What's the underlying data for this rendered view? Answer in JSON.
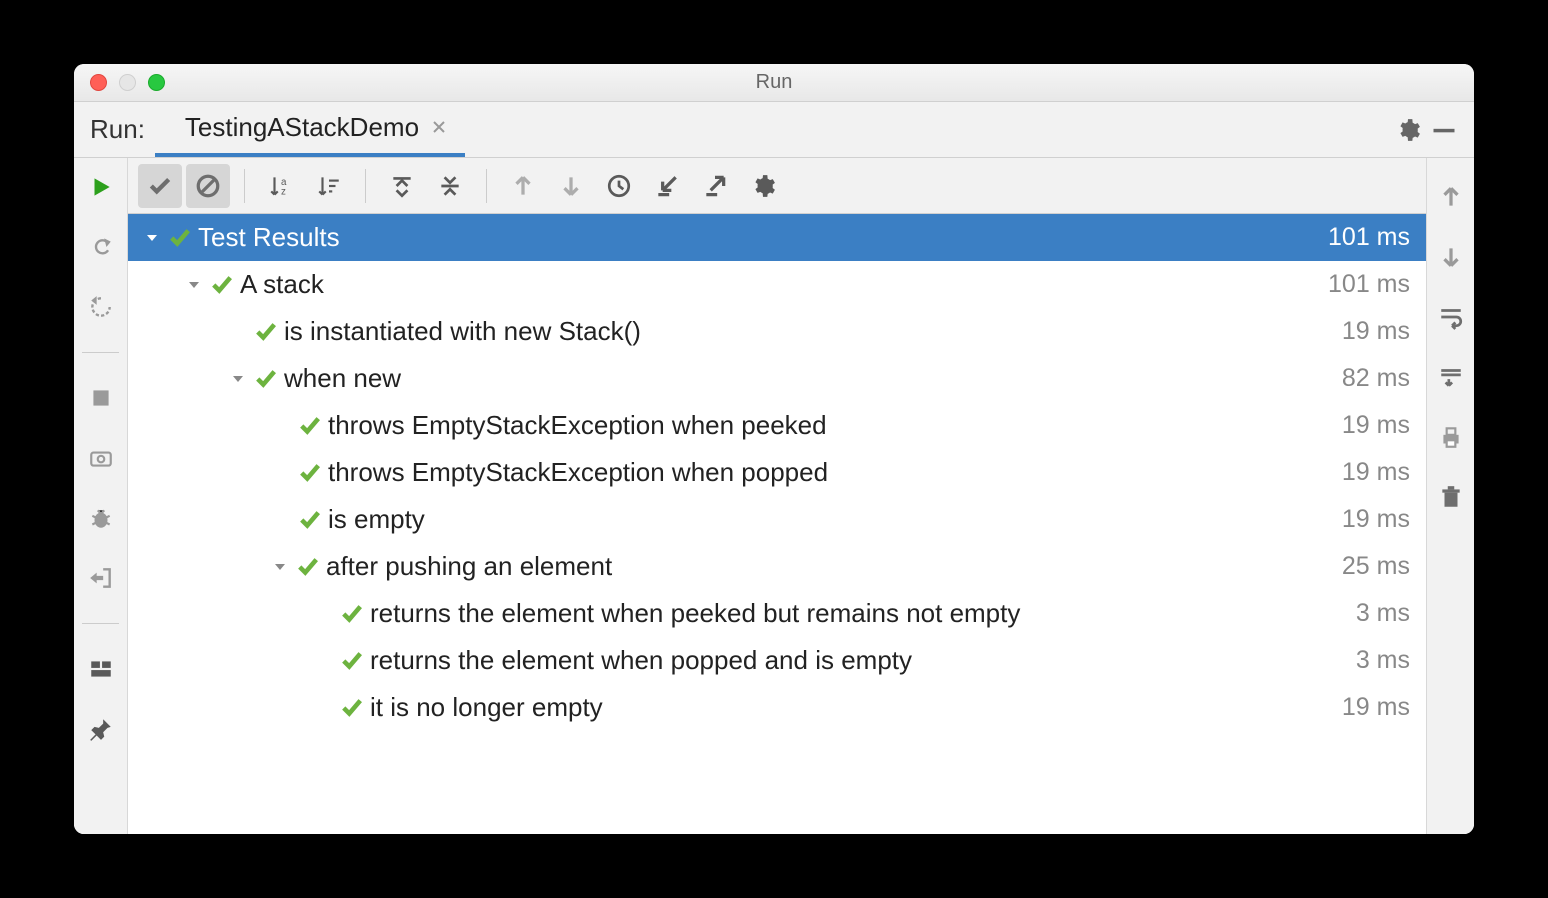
{
  "window": {
    "title": "Run"
  },
  "header": {
    "run_label": "Run:",
    "tab_name": "TestingAStackDemo"
  },
  "tree": {
    "root": {
      "label": "Test Results",
      "time": "101 ms"
    },
    "n1": {
      "label": "A stack",
      "time": "101 ms"
    },
    "n1_1": {
      "label": "is instantiated with new Stack()",
      "time": "19 ms"
    },
    "n1_2": {
      "label": "when new",
      "time": "82 ms"
    },
    "n1_2_1": {
      "label": "throws EmptyStackException when peeked",
      "time": "19 ms"
    },
    "n1_2_2": {
      "label": "throws EmptyStackException when popped",
      "time": "19 ms"
    },
    "n1_2_3": {
      "label": "is empty",
      "time": "19 ms"
    },
    "n1_3": {
      "label": "after pushing an element",
      "time": "25 ms"
    },
    "n1_3_1": {
      "label": "returns the element when peeked but remains not empty",
      "time": "3 ms"
    },
    "n1_3_2": {
      "label": "returns the element when popped and is empty",
      "time": "3 ms"
    },
    "n1_3_3": {
      "label": "it is no longer empty",
      "time": "19 ms"
    }
  }
}
